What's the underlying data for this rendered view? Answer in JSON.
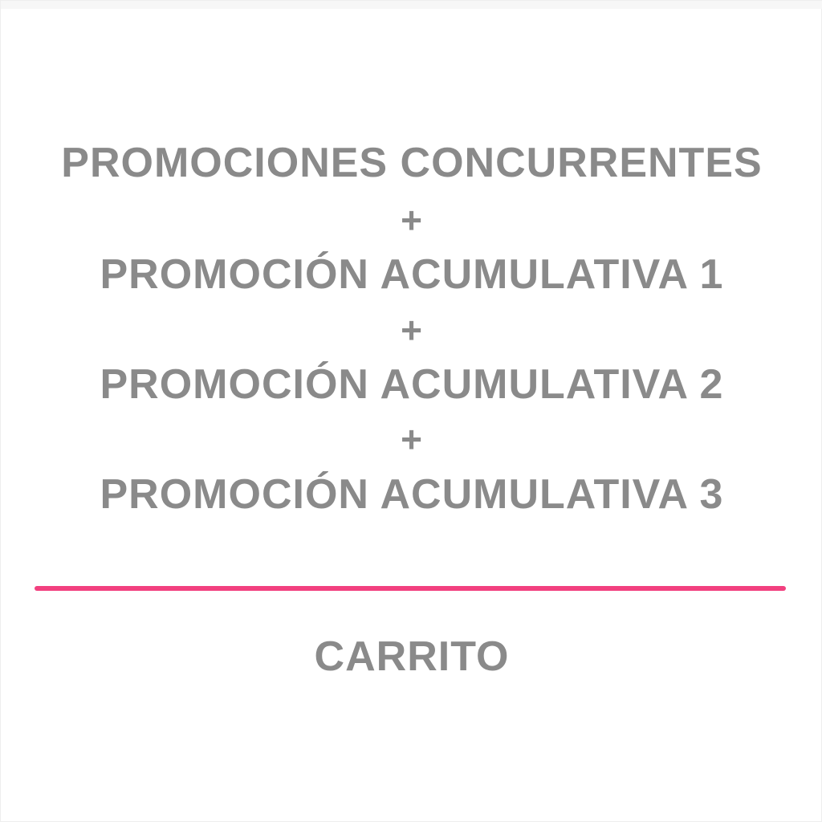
{
  "lines": {
    "concurrent": "PROMOCIONES CONCURRENTES",
    "plus_1": "+",
    "cumulative_1": "PROMOCIÓN ACUMULATIVA 1",
    "plus_2": "+",
    "cumulative_2": "PROMOCIÓN ACUMULATIVA 2",
    "plus_3": "+",
    "cumulative_3": "PROMOCIÓN ACUMULATIVA 3"
  },
  "result": "CARRITO",
  "colors": {
    "text": "#8a8a8a",
    "divider": "#f2407f",
    "background": "#ffffff"
  }
}
